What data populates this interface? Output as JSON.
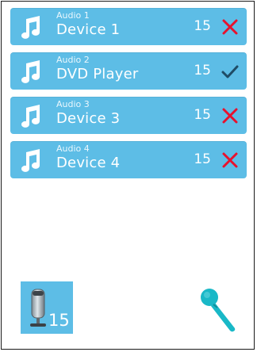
{
  "devices": [
    {
      "channel": "Audio 1",
      "name": "Device 1",
      "level": "15",
      "status": "x-icon"
    },
    {
      "channel": "Audio 2",
      "name": "DVD Player",
      "level": "15",
      "status": "check-icon"
    },
    {
      "channel": "Audio 3",
      "name": "Device 3",
      "level": "15",
      "status": "x-icon"
    },
    {
      "channel": "Audio 4",
      "name": "Device 4",
      "level": "15",
      "status": "x-icon"
    }
  ],
  "volume": {
    "value": "15"
  },
  "colors": {
    "row_bg": "#5dbde6",
    "x_red": "#e8112d",
    "check_dark": "#1f4c66",
    "mic_teal": "#19b8c7"
  }
}
